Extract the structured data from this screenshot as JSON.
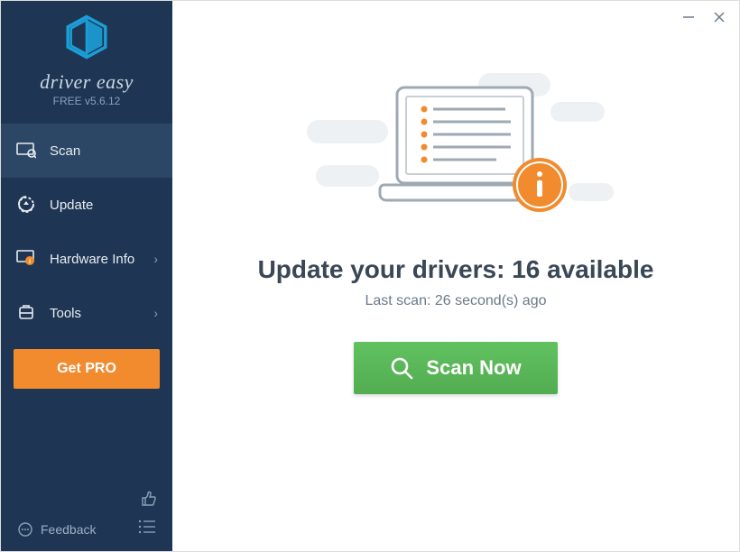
{
  "brand": {
    "name": "driver easy",
    "version": "FREE v5.6.12"
  },
  "nav": {
    "scan": "Scan",
    "update": "Update",
    "hardware": "Hardware Info",
    "tools": "Tools"
  },
  "getPro": "Get PRO",
  "footer": {
    "feedback": "Feedback"
  },
  "main": {
    "headline": "Update your drivers: 16 available",
    "sub": "Last scan: 26 second(s) ago",
    "scanButton": "Scan Now"
  },
  "colors": {
    "sidebar": "#1e3654",
    "sidebarActive": "#2c4766",
    "accentOrange": "#f28a2e",
    "accentGreen": "#58b757",
    "logoBlue": "#1b9ed6"
  }
}
